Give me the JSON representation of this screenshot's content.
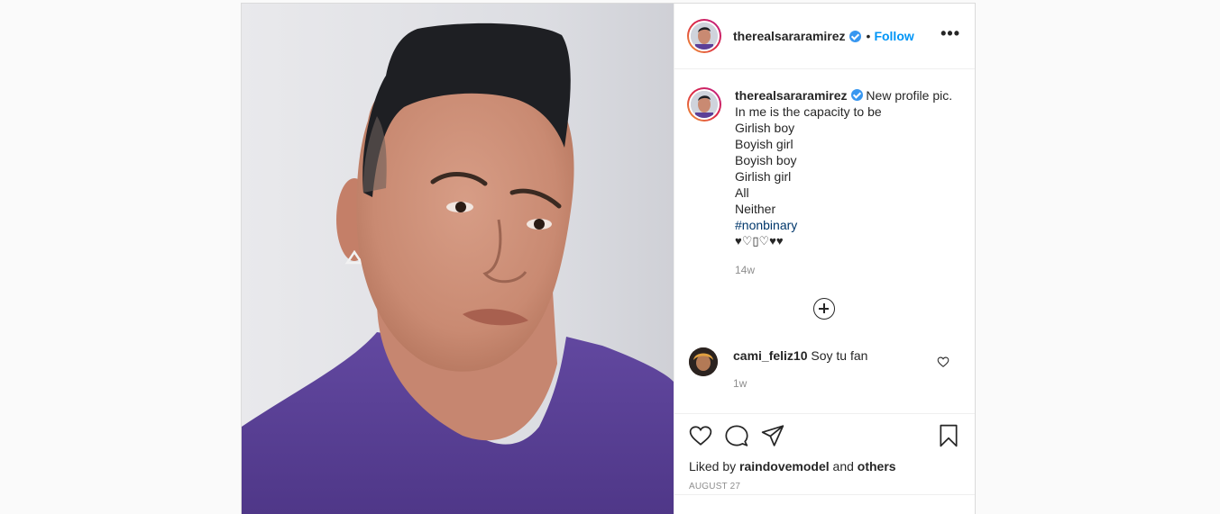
{
  "post": {
    "username": "therealsararamirez",
    "separator": "•",
    "follow_label": "Follow",
    "more_label": "•••"
  },
  "caption": {
    "username": "therealsararamirez",
    "lines": [
      "New profile pic.",
      "In me is the capacity to be",
      "Girlish boy",
      "Boyish girl",
      "Boyish boy",
      "Girlish girl",
      "All",
      "Neither"
    ],
    "hashtag": "#nonbinary",
    "hearts": "♥♡▯♡♥♥",
    "timestamp": "14w"
  },
  "comment": {
    "username": "cami_feliz10",
    "text": "Soy tu fan",
    "timestamp": "1w"
  },
  "actions": {
    "liked_prefix": "Liked by",
    "liked_user": "raindovemodel",
    "liked_and": "and",
    "liked_others": "others",
    "date": "AUGUST 27"
  },
  "icons": {
    "like": "heart-icon",
    "comment": "comment-bubble-icon",
    "share": "paper-plane-icon",
    "save": "bookmark-icon",
    "load_more": "plus-circle-icon",
    "verified": "verified-badge-icon"
  },
  "colors": {
    "follow": "#0095f6",
    "verified": "#3897f0",
    "hashtag": "#00376b",
    "shirt": "#5b3f98"
  }
}
